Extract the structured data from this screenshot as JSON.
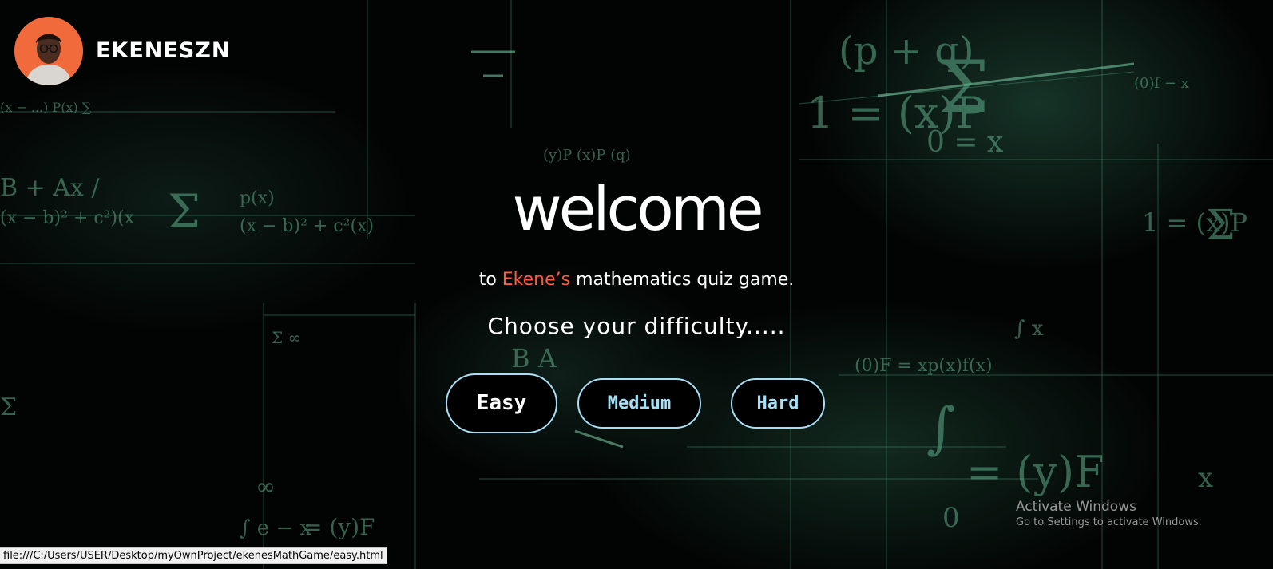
{
  "header": {
    "username": "EKENESZN"
  },
  "hero": {
    "title": "welcome",
    "subtitle_prefix": "to ",
    "subtitle_name": "Ekene’s",
    "subtitle_suffix": " mathematics quiz game.",
    "prompt": "Choose your difficulty....."
  },
  "difficulty": {
    "easy": "Easy",
    "medium": "Medium",
    "hard": "Hard"
  },
  "watermark": {
    "title": "Activate Windows",
    "subtitle": "Go to Settings to activate Windows."
  },
  "status_bar": {
    "url": "file:///C:/Users/USER/Desktop/myOwnProject/ekenesMathGame/easy.html"
  },
  "colors": {
    "accent_name": "#ff5a3d",
    "button_border": "#a9dff5",
    "avatar_bg": "#f06a3c"
  }
}
